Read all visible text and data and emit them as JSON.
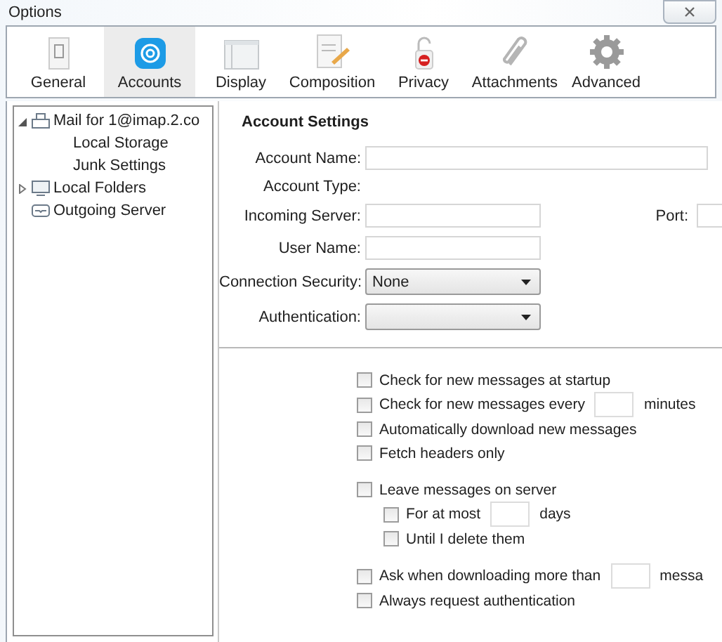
{
  "window": {
    "title": "Options"
  },
  "tabs": [
    {
      "label": "General",
      "selected": false
    },
    {
      "label": "Accounts",
      "selected": true
    },
    {
      "label": "Display",
      "selected": false
    },
    {
      "label": "Composition",
      "selected": false
    },
    {
      "label": "Privacy",
      "selected": false
    },
    {
      "label": "Attachments",
      "selected": false
    },
    {
      "label": "Advanced",
      "selected": false
    }
  ],
  "tree": [
    {
      "label": "Mail for 1@imap.2.co",
      "kind": "account",
      "expanded": true,
      "children": [
        {
          "label": "Local Storage"
        },
        {
          "label": "Junk Settings"
        }
      ]
    },
    {
      "label": "Local Folders",
      "kind": "folder",
      "expanded": false
    },
    {
      "label": "Outgoing Server",
      "kind": "server"
    }
  ],
  "settings": {
    "title": "Account Settings",
    "fields": [
      {
        "label": "Account Name:",
        "kind": "wide_text"
      },
      {
        "label": "Account Type:",
        "kind": "static"
      },
      {
        "label": "Incoming Server:",
        "kind": "text",
        "extra_label": "Port:"
      },
      {
        "label": "User Name:",
        "kind": "text"
      },
      {
        "label": "Connection Security:",
        "kind": "select",
        "value": "None"
      },
      {
        "label": "Authentication:",
        "kind": "select"
      }
    ],
    "option_groups": [
      [
        {
          "label": "Check for new messages at startup",
          "kind": "check",
          "checked": false
        },
        {
          "label": "Check for new messages every",
          "kind": "check_field",
          "suffix": "minutes",
          "checked": false
        },
        {
          "label": "Automatically download new messages",
          "kind": "check",
          "checked": false
        },
        {
          "label": "Fetch headers only",
          "kind": "check",
          "checked": false
        }
      ],
      [
        {
          "label": "Leave messages on server",
          "kind": "check",
          "checked": false,
          "children": [
            {
              "label": "For at most",
              "kind": "check_field",
              "suffix": "days",
              "checked": false
            },
            {
              "label": "Until I delete them",
              "kind": "check",
              "checked": false
            }
          ]
        }
      ],
      [
        {
          "label": "Ask when downloading more than",
          "kind": "check_field",
          "suffix": "messa",
          "checked": false
        },
        {
          "label": "Always request authentication",
          "kind": "check",
          "checked": false
        }
      ]
    ]
  }
}
